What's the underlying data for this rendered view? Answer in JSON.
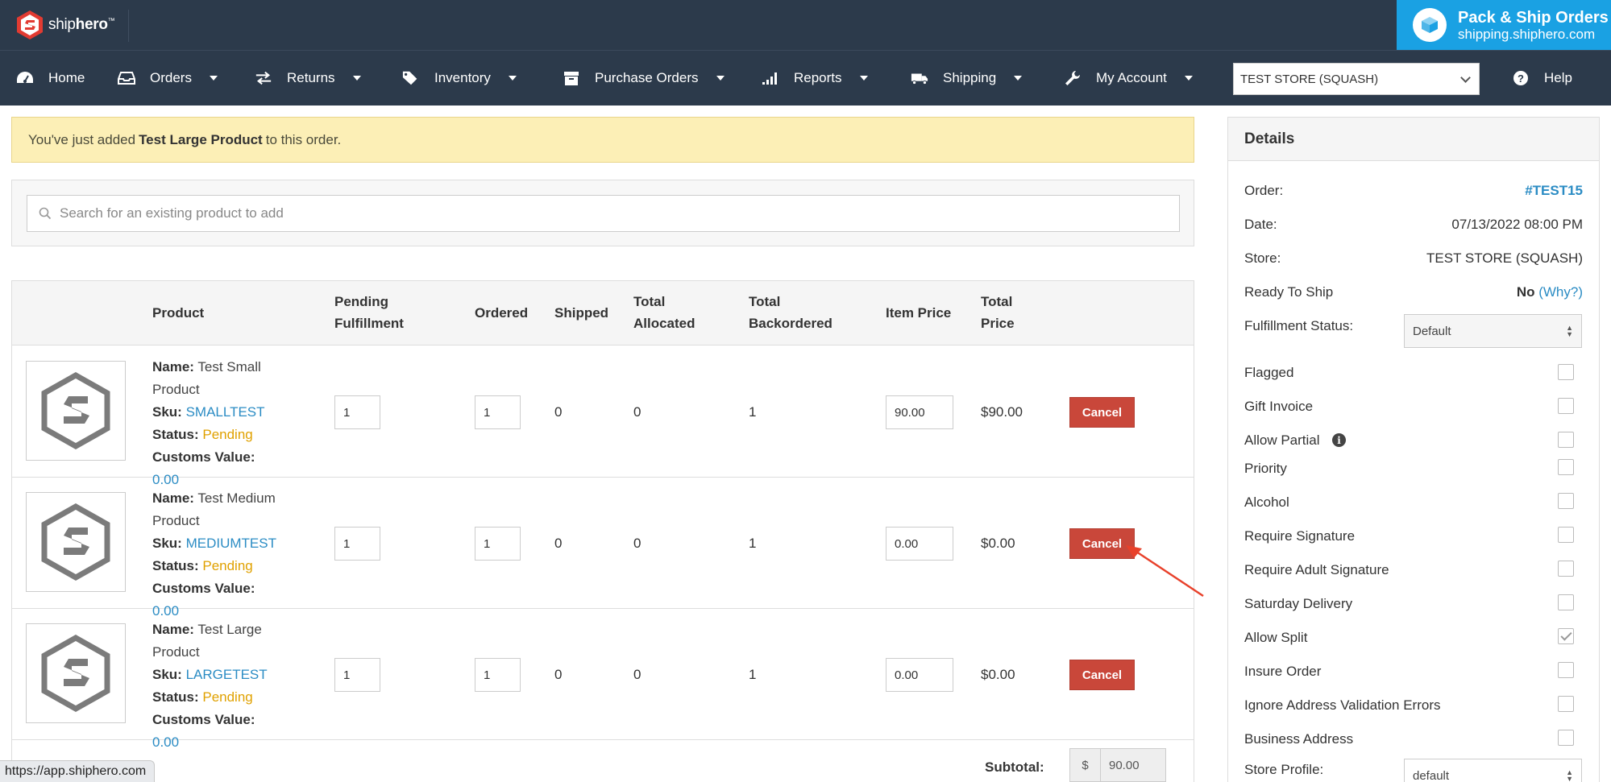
{
  "brand": {
    "name_light": "ship",
    "name_bold": "hero",
    "trademark": "™"
  },
  "pack_ship": {
    "title": "Pack & Ship Orders",
    "subtitle": "shipping.shiphero.com"
  },
  "nav": {
    "home": "Home",
    "orders": "Orders",
    "returns": "Returns",
    "inventory": "Inventory",
    "purchase_orders": "Purchase Orders",
    "reports": "Reports",
    "shipping": "Shipping",
    "my_account": "My Account",
    "store_select": "TEST STORE (SQUASH)",
    "help": "Help"
  },
  "alert": {
    "prefix": "You've just added",
    "product": "Test Large Product",
    "suffix": "to this order."
  },
  "search": {
    "placeholder": "Search for an existing product to add"
  },
  "table": {
    "headers": {
      "product": "Product",
      "pending_line1": "Pending",
      "pending_line2": "Fulfillment",
      "ordered": "Ordered",
      "shipped": "Shipped",
      "allocated_line1": "Total",
      "allocated_line2": "Allocated",
      "backordered_line1": "Total",
      "backordered_line2": "Backordered",
      "item_price": "Item Price",
      "total_price_line1": "Total",
      "total_price_line2": "Price"
    },
    "labels": {
      "name": "Name:",
      "sku": "Sku:",
      "status": "Status:",
      "customs": "Customs Value:"
    },
    "rows": [
      {
        "name_line1": "Test Small",
        "name_line2": "Product",
        "sku": "SMALLTEST",
        "status": "Pending",
        "customs": "0.00",
        "pending": "1",
        "ordered": "1",
        "shipped": "0",
        "allocated": "0",
        "backordered": "1",
        "item_price": "90.00",
        "total": "$90.00",
        "cancel": "Cancel"
      },
      {
        "name_line1": "Test Medium",
        "name_line2": "Product",
        "sku": "MEDIUMTEST",
        "status": "Pending",
        "customs": "0.00",
        "pending": "1",
        "ordered": "1",
        "shipped": "0",
        "allocated": "0",
        "backordered": "1",
        "item_price": "0.00",
        "total": "$0.00",
        "cancel": "Cancel"
      },
      {
        "name_line1": "Test Large",
        "name_line2": "Product",
        "sku": "LARGETEST",
        "status": "Pending",
        "customs": "0.00",
        "pending": "1",
        "ordered": "1",
        "shipped": "0",
        "allocated": "0",
        "backordered": "1",
        "item_price": "0.00",
        "total": "$0.00",
        "cancel": "Cancel"
      }
    ],
    "subtotal": {
      "label": "Subtotal:",
      "currency": "$",
      "value": "90.00"
    }
  },
  "details": {
    "title": "Details",
    "order_label": "Order:",
    "order_value": "#TEST15",
    "date_label": "Date:",
    "date_value": "07/13/2022 08:00 PM",
    "store_label": "Store:",
    "store_value": "TEST STORE (SQUASH)",
    "ready_label": "Ready To Ship",
    "ready_value": "No",
    "ready_why": "(Why?)",
    "fulfillment_label": "Fulfillment Status:",
    "fulfillment_value": "Default",
    "flags": [
      {
        "label": "Flagged",
        "checked": false
      },
      {
        "label": "Gift Invoice",
        "checked": false
      },
      {
        "label": "Allow Partial",
        "checked": false
      },
      {
        "label": "Priority",
        "checked": false
      },
      {
        "label": "Alcohol",
        "checked": false
      },
      {
        "label": "Require Signature",
        "checked": false
      },
      {
        "label": "Require Adult Signature",
        "checked": false
      },
      {
        "label": "Saturday Delivery",
        "checked": false
      },
      {
        "label": "Allow Split",
        "checked": true
      },
      {
        "label": "Insure Order",
        "checked": false
      },
      {
        "label": "Ignore Address Validation Errors",
        "checked": false
      },
      {
        "label": "Business Address",
        "checked": false
      }
    ],
    "store_profile_label": "Store Profile:",
    "store_profile_value": "default"
  },
  "status_url": "https://app.shiphero.com",
  "colors": {
    "nav_bg": "#2c3a4b",
    "accent_blue": "#1aa1e3",
    "cancel_red": "#c9473a",
    "pending_orange": "#e0a100",
    "link_blue": "#2b8cc4",
    "alert_bg": "#fcefb6",
    "annotation_arrow": "#e8412b"
  }
}
